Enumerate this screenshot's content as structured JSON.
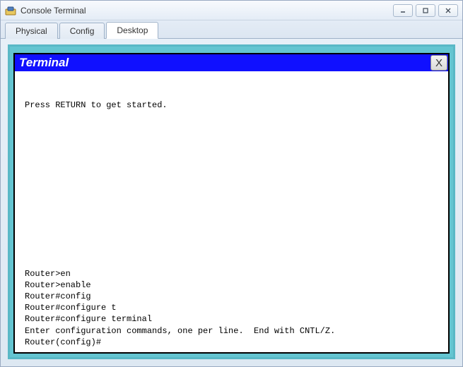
{
  "window": {
    "title": "Console Terminal"
  },
  "tabs": {
    "physical": "Physical",
    "config": "Config",
    "desktop": "Desktop"
  },
  "terminal": {
    "title": "Terminal",
    "close_label": "X",
    "lines": {
      "intro": "Press RETURN to get started.",
      "l1": "Router>en",
      "l2": "Router>enable",
      "l3": "Router#config",
      "l4": "Router#configure t",
      "l5": "Router#configure terminal",
      "l6": "Enter configuration commands, one per line.  End with CNTL/Z.",
      "l7": "Router(config)#"
    }
  }
}
